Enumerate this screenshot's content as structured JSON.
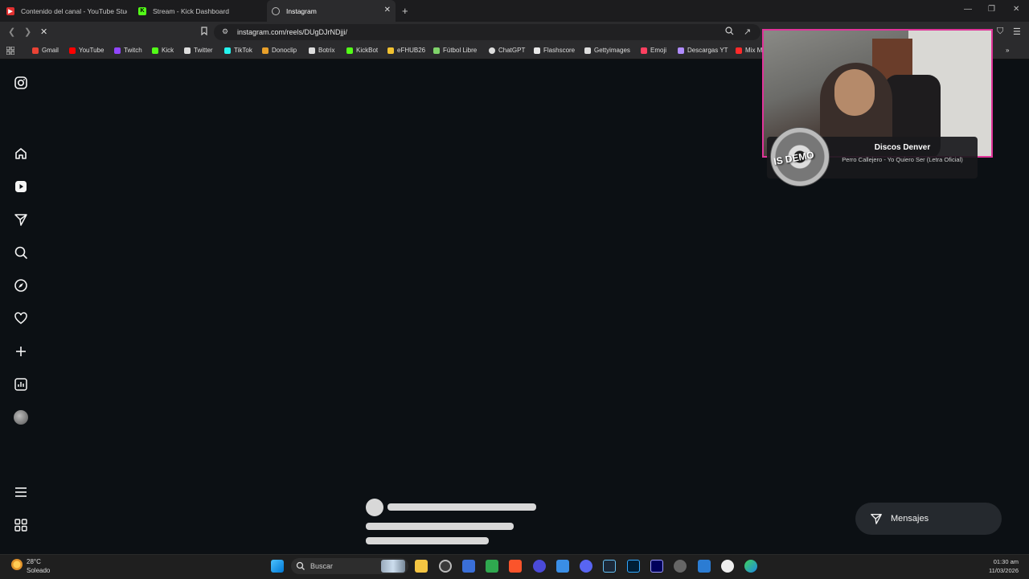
{
  "browser": {
    "tabs": [
      {
        "label": "Contenido del canal - YouTube Studio",
        "color": "#e03030"
      },
      {
        "label": "Stream - Kick Dashboard",
        "color": "#53fc18"
      },
      {
        "label": "Instagram",
        "color": "#bbbbbb"
      }
    ],
    "url": "instagram.com/reels/DUgDJrNDjji/",
    "bookmarks": [
      {
        "label": "Gmail",
        "color": "#ea4335"
      },
      {
        "label": "YouTube",
        "color": "#ff0000"
      },
      {
        "label": "Twitch",
        "color": "#9146ff"
      },
      {
        "label": "Kick",
        "color": "#53fc18"
      },
      {
        "label": "Twitter",
        "color": "#dddddd"
      },
      {
        "label": "TikTok",
        "color": "#25f4ee"
      },
      {
        "label": "Donoclip",
        "color": "#e8a02a"
      },
      {
        "label": "Botrix",
        "color": "#dddddd"
      },
      {
        "label": "KickBot",
        "color": "#53fc18"
      },
      {
        "label": "eFHUB26",
        "color": "#f2c230"
      },
      {
        "label": "Fútbol Libre",
        "color": "#7fd36a"
      },
      {
        "label": "ChatGPT",
        "color": "#dddddd"
      },
      {
        "label": "Flashscore",
        "color": "#e8e8e8"
      },
      {
        "label": "Gettyimages",
        "color": "#dddddd"
      },
      {
        "label": "Emoji",
        "color": "#ff4060"
      },
      {
        "label": "Descargas YT",
        "color": "#b08cff"
      },
      {
        "label": "Mix M",
        "color": "#ff2a2a"
      }
    ]
  },
  "sidebar": {
    "items": [
      {
        "name": "instagram-logo-icon"
      },
      {
        "name": "home-icon"
      },
      {
        "name": "reels-icon"
      },
      {
        "name": "direct-icon"
      },
      {
        "name": "search-icon"
      },
      {
        "name": "explore-icon"
      },
      {
        "name": "heart-icon"
      },
      {
        "name": "create-icon"
      },
      {
        "name": "dashboard-icon"
      },
      {
        "name": "profile-avatar"
      },
      {
        "name": "menu-icon"
      },
      {
        "name": "apps-icon"
      }
    ]
  },
  "overlay": {
    "artist": "Discos Denver",
    "song": "Perro Callejero - Yo Quiero Ser (Letra Oficial)",
    "disc_text": "IS DEMO"
  },
  "messages_button": {
    "label": "Mensajes"
  },
  "taskbar": {
    "temperature": "28°C",
    "weather": "Soleado",
    "search_placeholder": "Buscar",
    "time": "01:30 am",
    "date": "11/03/2026"
  }
}
